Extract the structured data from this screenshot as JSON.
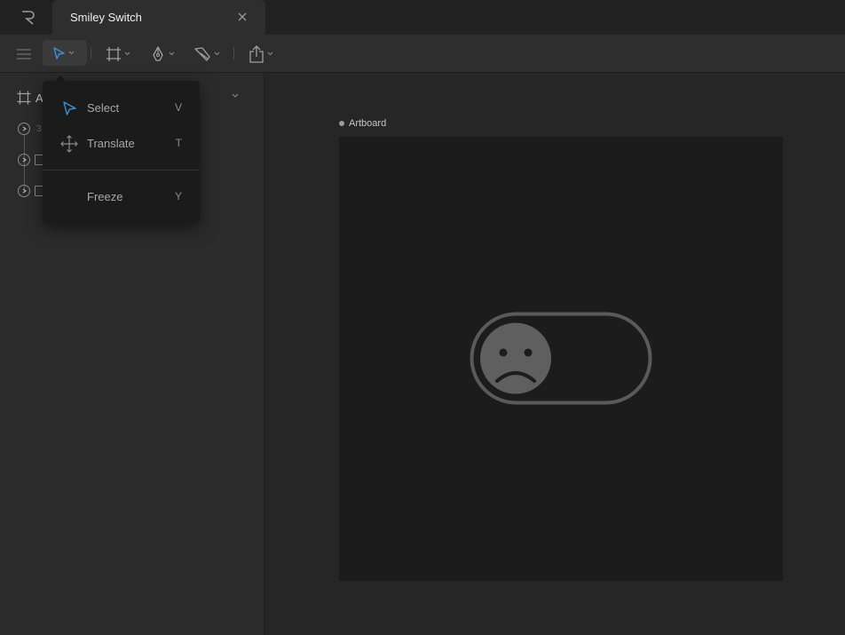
{
  "titlebar": {
    "document_tab": "Smiley Switch"
  },
  "left_panel": {
    "header_label": "A",
    "layer_partial_text": "3"
  },
  "canvas": {
    "artboard_label": "Artboard"
  },
  "tool_menu": {
    "items": [
      {
        "label": "Select",
        "shortcut": "V",
        "icon": "arrow-pointer-icon"
      },
      {
        "label": "Translate",
        "shortcut": "T",
        "icon": "move-arrows-icon"
      },
      {
        "label": "Freeze",
        "shortcut": "Y",
        "icon": ""
      }
    ]
  },
  "colors": {
    "accent": "#3d8fd6",
    "artboard": "#1c1c1c",
    "switch_stroke": "#5a5a5a",
    "knob": "#5f5f5f"
  }
}
